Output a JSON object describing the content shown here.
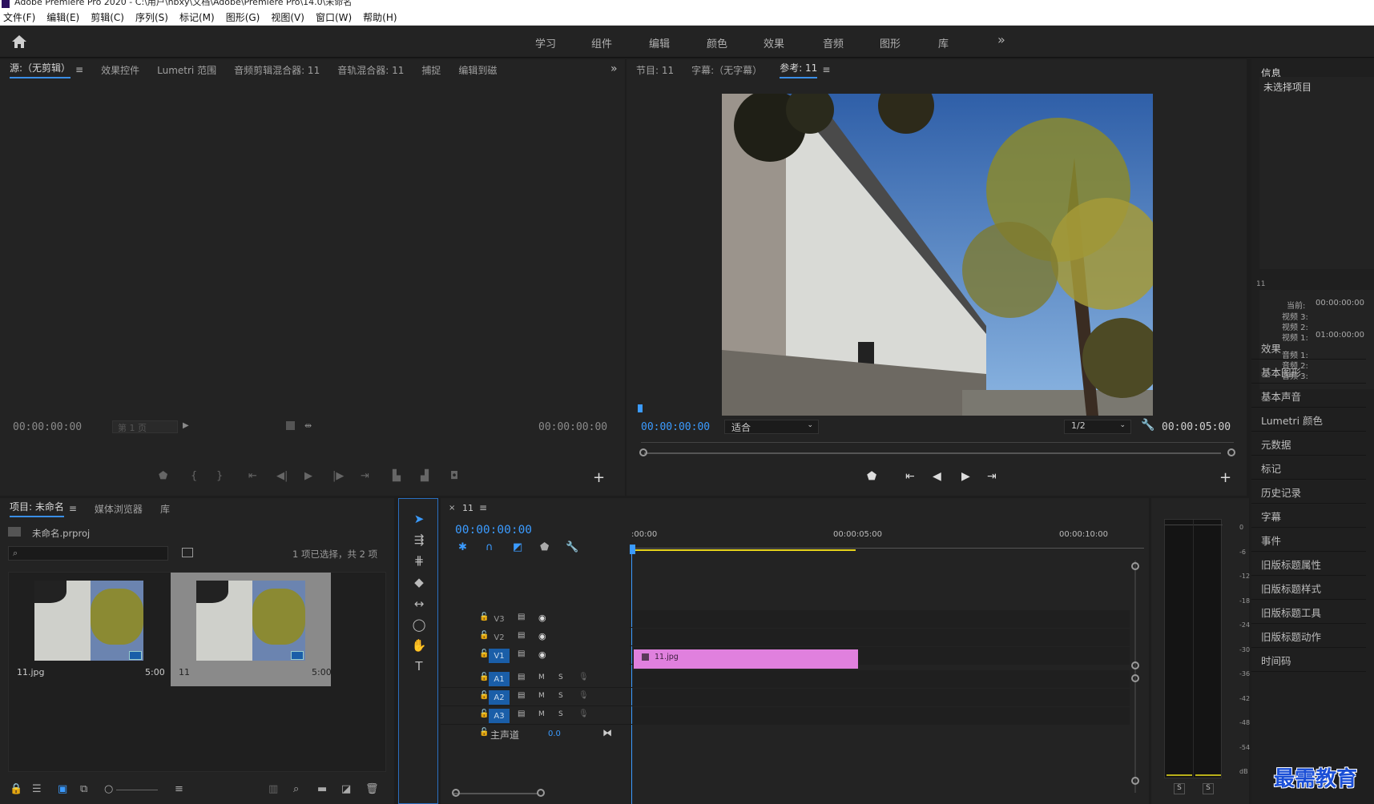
{
  "window": {
    "title": "Adobe Premiere Pro 2020 - C:\\用户\\hbxy\\文档\\Adobe\\Premiere Pro\\14.0\\未命名"
  },
  "menu": [
    "文件(F)",
    "编辑(E)",
    "剪辑(C)",
    "序列(S)",
    "标记(M)",
    "图形(G)",
    "视图(V)",
    "窗口(W)",
    "帮助(H)"
  ],
  "workspaces": [
    "学习",
    "组件",
    "编辑",
    "颜色",
    "效果",
    "音频",
    "图形",
    "库"
  ],
  "source_panel": {
    "tabs": [
      "源:（无剪辑）",
      "效果控件",
      "Lumetri 范围",
      "音频剪辑混合器: 11",
      "音轨混合器: 11",
      "捕捉",
      "编辑到磁"
    ],
    "timecode_left": "00:00:00:00",
    "page": "第 1 页",
    "timecode_right": "00:00:00:00"
  },
  "program_panel": {
    "tabs": [
      "节目: 11",
      "字幕:（无字幕）",
      "参考: 11"
    ],
    "timecode_left": "00:00:00:00",
    "fit": "适合",
    "resolution": "1/2",
    "timecode_right": "00:00:05:00"
  },
  "info_panel": {
    "title": "信息",
    "none_selected": "未选择项目",
    "seq": "11",
    "current_label": "当前:",
    "current": "00:00:00:00",
    "video3": "视频 3:",
    "video2": "视频 2:",
    "video1": "视频 1:",
    "video1_val": "01:00:00:00",
    "audio1": "音频 1:",
    "audio2": "音频 2:",
    "audio3": "音频 3:"
  },
  "right_items": [
    "效果",
    "基本图形",
    "基本声音",
    "Lumetri 颜色",
    "元数据",
    "标记",
    "历史记录",
    "字幕",
    "事件",
    "旧版标题属性",
    "旧版标题样式",
    "旧版标题工具",
    "旧版标题动作",
    "时间码"
  ],
  "project_panel": {
    "tabs": [
      "项目: 未命名",
      "媒体浏览器",
      "库"
    ],
    "file": "未命名.prproj",
    "count": "1 项已选择，共 2 项",
    "items": [
      {
        "name": "11.jpg",
        "dur": "5:00"
      },
      {
        "name": "11",
        "dur": "5:00"
      }
    ]
  },
  "timeline": {
    "tab": "11",
    "timecode": "00:00:00:00",
    "ruler": [
      ":00:00",
      "00:00:05:00",
      "00:00:10:00"
    ],
    "video_tracks": [
      "V3",
      "V2",
      "V1"
    ],
    "audio_tracks": [
      "A1",
      "A2",
      "A3"
    ],
    "mute": "M",
    "solo": "S",
    "master": "主声道",
    "master_val": "0.0",
    "clip": "11.jpg",
    "clip_color": "#e080de"
  },
  "meter": {
    "labels": [
      "0",
      "-6",
      "-12",
      "-18",
      "-24",
      "-30",
      "-36",
      "-42",
      "-48",
      "-54",
      "dB"
    ],
    "solo": [
      "S",
      "S"
    ]
  },
  "watermark": "最需教育"
}
